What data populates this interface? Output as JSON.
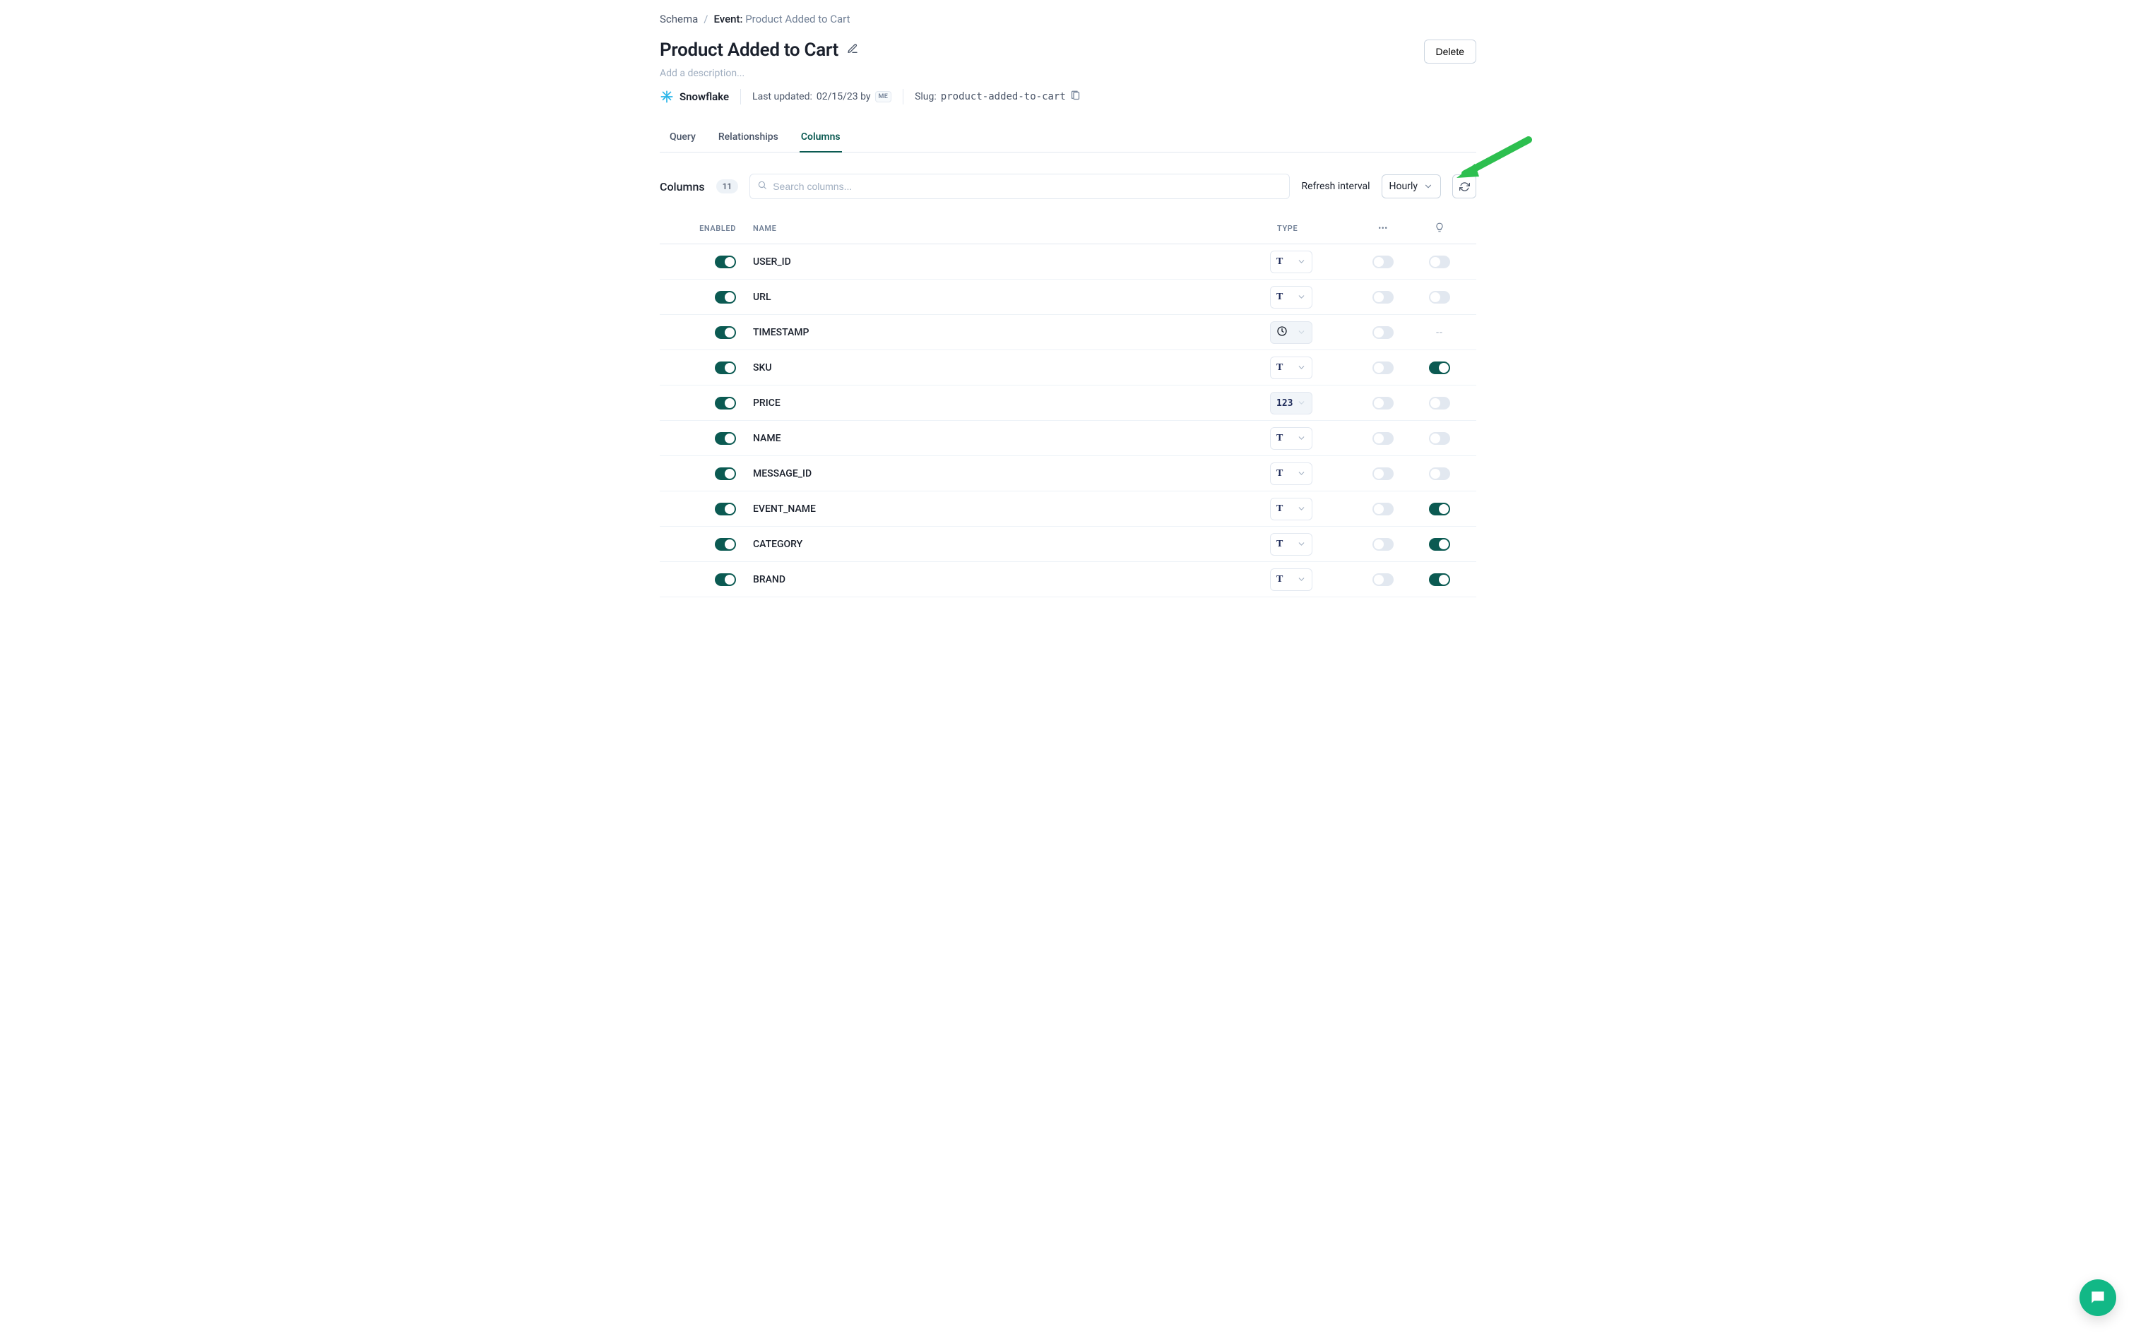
{
  "breadcrumb": {
    "root": "Schema",
    "prefix": "Event:",
    "current": "Product Added to Cart"
  },
  "header": {
    "title": "Product Added to Cart",
    "description_placeholder": "Add a description...",
    "delete_label": "Delete"
  },
  "source": {
    "name": "Snowflake"
  },
  "meta": {
    "last_updated_label": "Last updated:",
    "last_updated_value": "02/15/23 by",
    "updated_badge": "ME",
    "slug_label": "Slug:",
    "slug_value": "product-added-to-cart"
  },
  "tabs": {
    "items": [
      "Query",
      "Relationships",
      "Columns"
    ],
    "active_index": 2
  },
  "columns_bar": {
    "label": "Columns",
    "count": "11",
    "search_placeholder": "Search columns...",
    "refresh_label": "Refresh interval",
    "refresh_value": "Hourly"
  },
  "table": {
    "headers": {
      "enabled": "ENABLED",
      "name": "NAME",
      "type": "TYPE",
      "pii": "•••"
    },
    "rows": [
      {
        "enabled": true,
        "name": "USER_ID",
        "type": "text",
        "type_disabled": false,
        "pii": false,
        "lamp": "off"
      },
      {
        "enabled": true,
        "name": "URL",
        "type": "text",
        "type_disabled": false,
        "pii": false,
        "lamp": "off"
      },
      {
        "enabled": true,
        "name": "TIMESTAMP",
        "type": "timestamp",
        "type_disabled": true,
        "pii": false,
        "lamp": "dash"
      },
      {
        "enabled": true,
        "name": "SKU",
        "type": "text",
        "type_disabled": false,
        "pii": false,
        "lamp": "on"
      },
      {
        "enabled": true,
        "name": "PRICE",
        "type": "number",
        "type_disabled": true,
        "pii": false,
        "lamp": "off"
      },
      {
        "enabled": true,
        "name": "NAME",
        "type": "text",
        "type_disabled": false,
        "pii": false,
        "lamp": "off"
      },
      {
        "enabled": true,
        "name": "MESSAGE_ID",
        "type": "text",
        "type_disabled": false,
        "pii": false,
        "lamp": "off"
      },
      {
        "enabled": true,
        "name": "EVENT_NAME",
        "type": "text",
        "type_disabled": false,
        "pii": false,
        "lamp": "on"
      },
      {
        "enabled": true,
        "name": "CATEGORY",
        "type": "text",
        "type_disabled": false,
        "pii": false,
        "lamp": "on"
      },
      {
        "enabled": true,
        "name": "BRAND",
        "type": "text",
        "type_disabled": false,
        "pii": false,
        "lamp": "on"
      }
    ]
  },
  "annotation": {
    "dash": "--"
  }
}
